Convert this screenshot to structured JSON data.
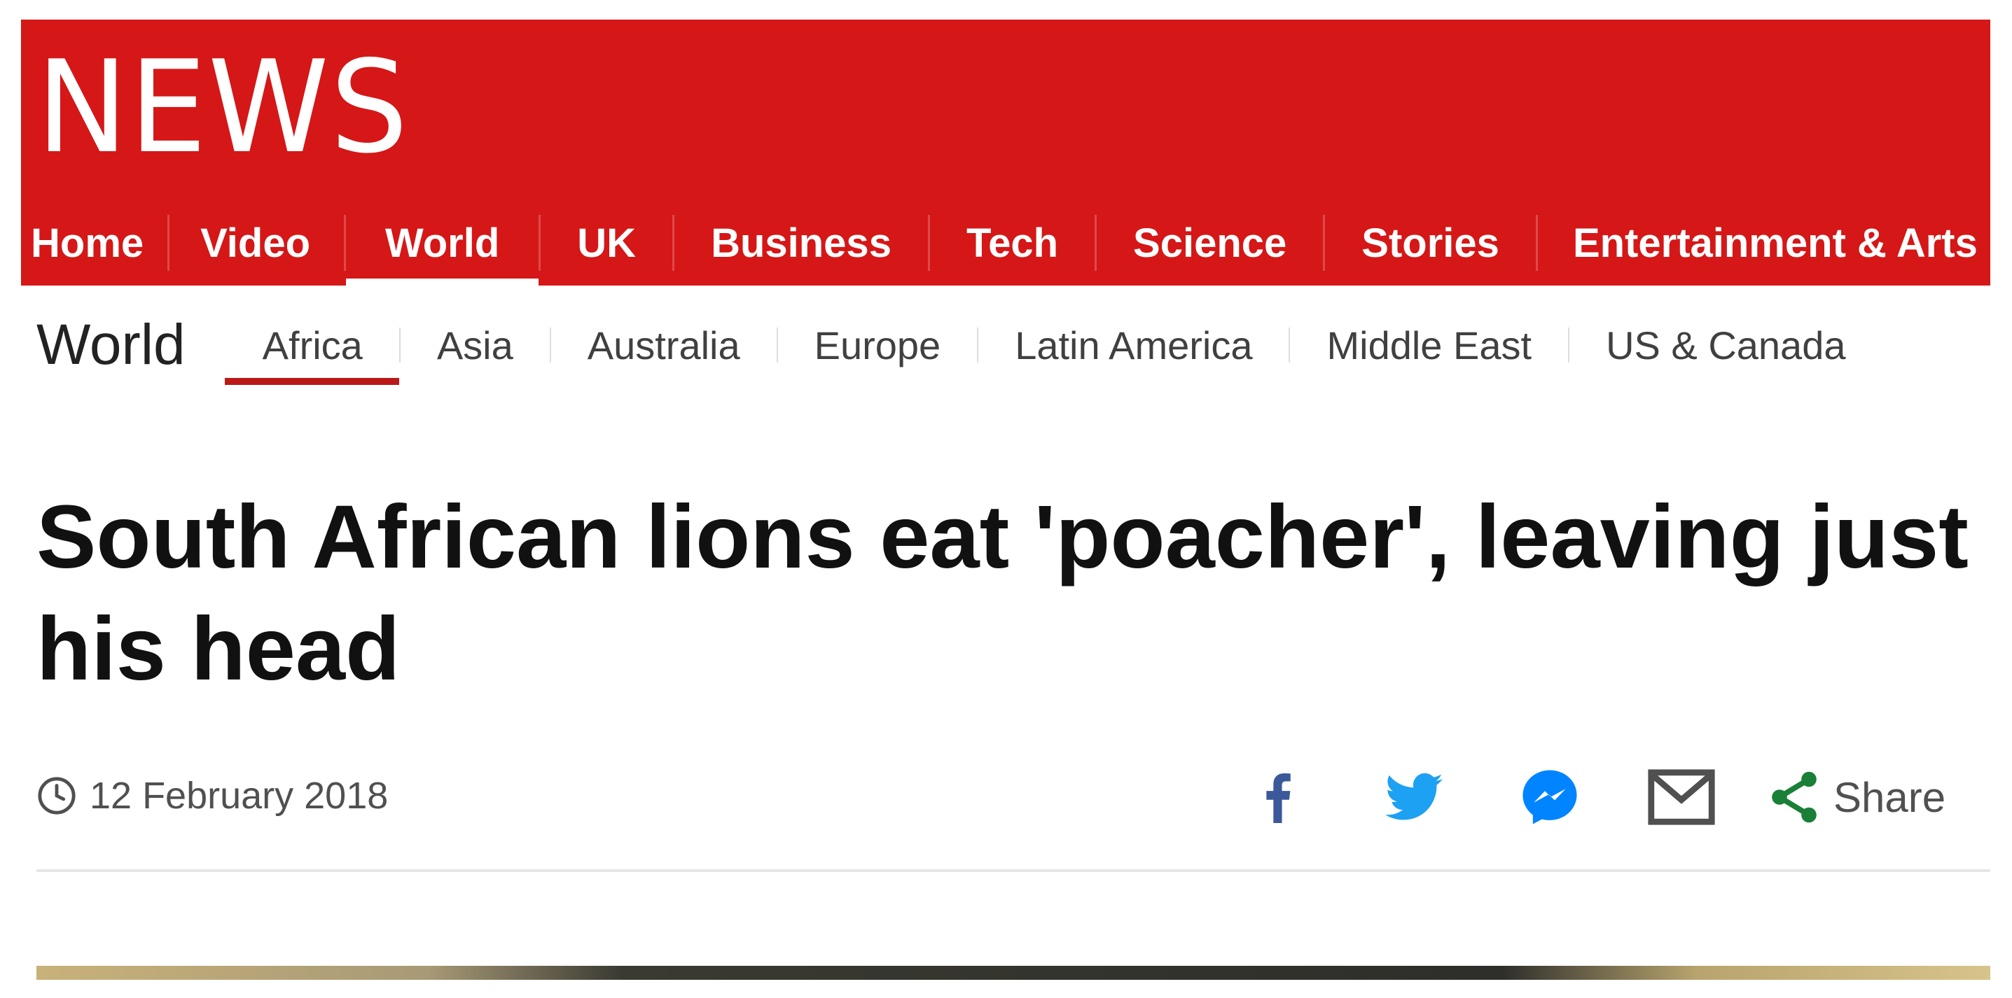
{
  "header": {
    "logo_text": "NEWS",
    "brand_color": "#d51717",
    "nav": [
      {
        "label": "Home",
        "active": false
      },
      {
        "label": "Video",
        "active": false
      },
      {
        "label": "World",
        "active": true
      },
      {
        "label": "UK",
        "active": false
      },
      {
        "label": "Business",
        "active": false
      },
      {
        "label": "Tech",
        "active": false
      },
      {
        "label": "Science",
        "active": false
      },
      {
        "label": "Stories",
        "active": false
      },
      {
        "label": "Entertainment & Arts",
        "active": false
      }
    ]
  },
  "section": {
    "title": "World",
    "accent_color": "#bb1919",
    "items": [
      {
        "label": "Africa",
        "active": true
      },
      {
        "label": "Asia",
        "active": false
      },
      {
        "label": "Australia",
        "active": false
      },
      {
        "label": "Europe",
        "active": false
      },
      {
        "label": "Latin America",
        "active": false
      },
      {
        "label": "Middle East",
        "active": false
      },
      {
        "label": "US & Canada",
        "active": false
      }
    ]
  },
  "article": {
    "headline": "South African lions eat 'poacher', leaving just his head",
    "date": "12 February 2018",
    "date_icon": "clock-icon",
    "share": {
      "icons": [
        "facebook-icon",
        "twitter-icon",
        "messenger-icon",
        "email-icon"
      ],
      "label": "Share",
      "share_icon": "share-icon",
      "icon_colors": {
        "facebook": "#3b5998",
        "twitter": "#1da1f2",
        "messenger": "#0084ff",
        "email": "#505050",
        "share": "#1a7f37"
      }
    }
  }
}
